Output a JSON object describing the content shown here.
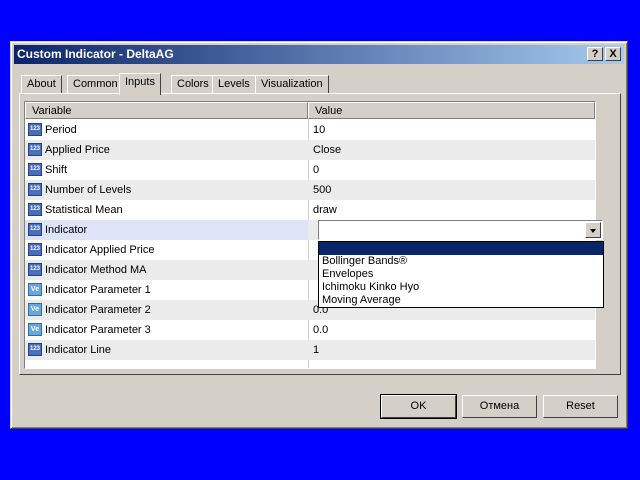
{
  "window": {
    "title": "Custom Indicator - DeltaAG",
    "help_button": "?",
    "close_button": "X"
  },
  "tabs": [
    {
      "label": "About"
    },
    {
      "label": "Common"
    },
    {
      "label": "Inputs"
    },
    {
      "label": "Colors"
    },
    {
      "label": "Levels"
    },
    {
      "label": "Visualization"
    }
  ],
  "active_tab": "Inputs",
  "grid": {
    "headers": {
      "variable": "Variable",
      "value": "Value"
    },
    "rows": [
      {
        "icon": "123",
        "variable": "Period",
        "value": "10"
      },
      {
        "icon": "123",
        "variable": "Applied Price",
        "value": "Close"
      },
      {
        "icon": "123",
        "variable": "Shift",
        "value": "0"
      },
      {
        "icon": "123",
        "variable": "Number of Levels",
        "value": "500"
      },
      {
        "icon": "123",
        "variable": "Statistical Mean",
        "value": "draw"
      },
      {
        "icon": "123",
        "variable": "Indicator",
        "value": ""
      },
      {
        "icon": "123",
        "variable": "Indicator Applied Price",
        "value": ""
      },
      {
        "icon": "123",
        "variable": "Indicator Method MA",
        "value": ""
      },
      {
        "icon": "Ve",
        "variable": "Indicator Parameter 1",
        "value": ""
      },
      {
        "icon": "Ve",
        "variable": "Indicator Parameter 2",
        "value": "0.0"
      },
      {
        "icon": "Ve",
        "variable": "Indicator Parameter 3",
        "value": "0.0"
      },
      {
        "icon": "123",
        "variable": "Indicator Line",
        "value": "1"
      }
    ]
  },
  "indicator_dropdown": {
    "selected": "",
    "options": [
      "",
      "Bollinger Bands®",
      "Envelopes",
      "Ichimoku Kinko Hyo",
      "Moving Average"
    ]
  },
  "buttons": {
    "ok": "OK",
    "cancel": "Отмена",
    "reset": "Reset"
  }
}
